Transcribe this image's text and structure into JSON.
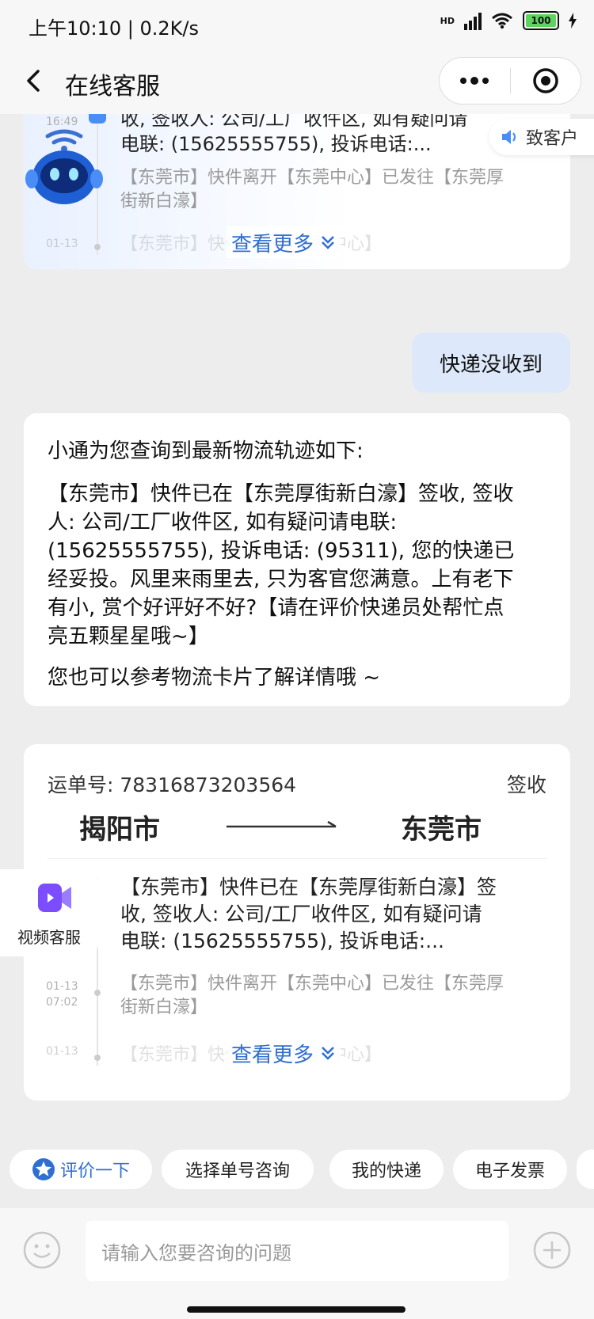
{
  "status_bar": {
    "time": "上午10:10 | 0.2K/s",
    "network": "HD",
    "battery": "100"
  },
  "nav": {
    "title": "在线客服"
  },
  "top_card": {
    "date_top": "16:49",
    "line1": "收, 签收人: 公司/工厂收件区, 如有疑问请",
    "line2": "电联: (15625555755), 投诉电话:...",
    "grey1": "【东莞市】快件离开【东莞中心】已发往【东莞厚",
    "grey2": "街新白濠】",
    "date_bottom": "01-13",
    "faded": "【东莞市】快件离开【东莞中心】",
    "more": "查看更多",
    "notify_label": "致客户"
  },
  "user_message": "快递没收到",
  "bot_reply": {
    "intro": "小通为您查询到最新物流轨迹如下:",
    "body_lines": [
      "【东莞市】快件已在【东莞厚街新白濠】签收, 签收",
      "人: 公司/工厂收件区, 如有疑问请电联:",
      "(15625555755), 投诉电话: (95311), 您的快递已",
      "经妥投。风里来雨里去, 只为客官您满意。上有老下",
      "有小, 赏个好评好不好?【请在评价快递员处帮忙点",
      "亮五颗星星哦~】"
    ],
    "outro": "您也可以参考物流卡片了解详情哦 ~"
  },
  "tracking_card": {
    "waybill_label": "运单号: 78316873203564",
    "status": "签收",
    "origin": "揭阳市",
    "destination": "东莞市",
    "event1": [
      "【东莞市】快件已在【东莞厚街新白濠】签",
      "收, 签收人: 公司/工厂收件区, 如有疑问请",
      "电联: (15625555755), 投诉电话:..."
    ],
    "event2_date": "01-13",
    "event2_time": "07:02",
    "event2": [
      "【东莞市】快件离开【东莞中心】已发往【东莞厚",
      "街新白濠】"
    ],
    "event3_date": "01-13",
    "event3_faded": "【东莞市】快件离开【东莞中心】",
    "more": "查看更多"
  },
  "float_video": {
    "label": "视频客服"
  },
  "chips": [
    "评价一下",
    "选择单号咨询",
    "我的快递",
    "电子发票"
  ],
  "input": {
    "placeholder": "请输入您要咨询的问题"
  },
  "colors": {
    "accent": "#2f6fcf",
    "bubble": "#dde9fa",
    "video": "#7b4dff"
  }
}
